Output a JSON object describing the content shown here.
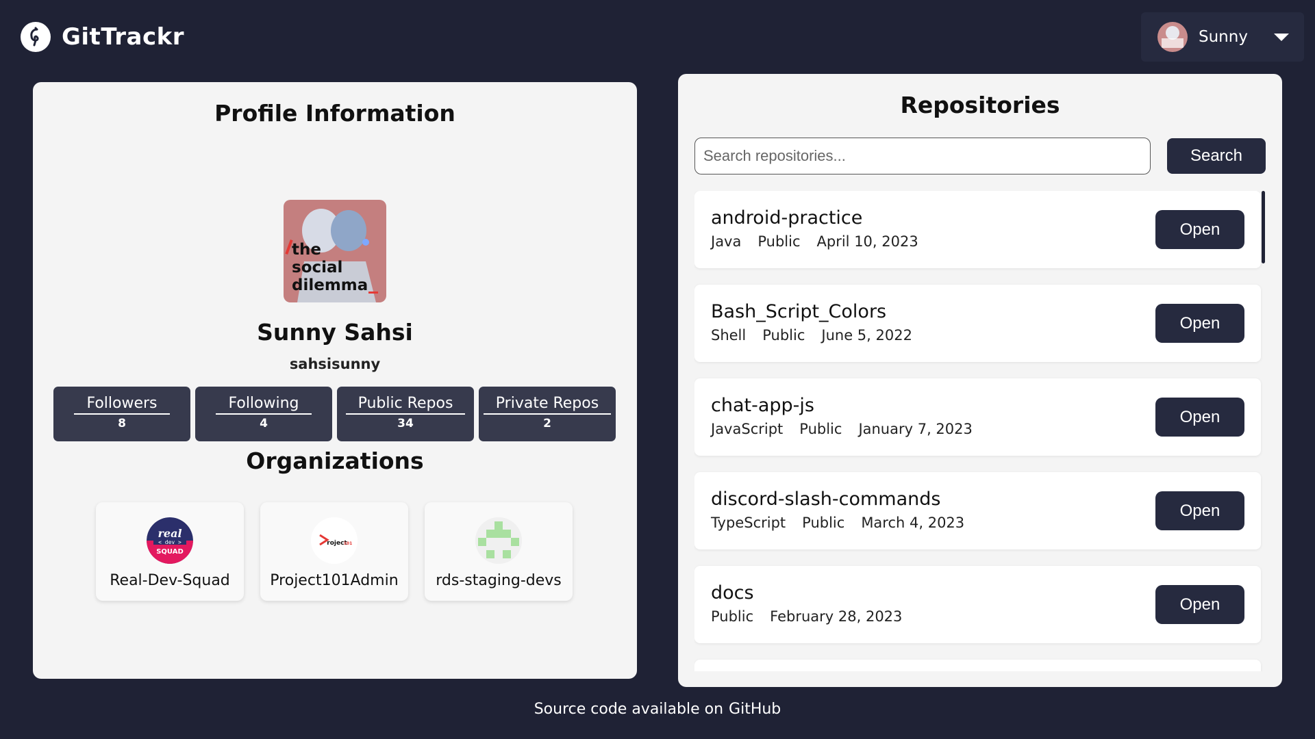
{
  "app": {
    "brand_name": "GitTrackr"
  },
  "user_menu": {
    "name": "Sunny"
  },
  "profile": {
    "title": "Profile Information",
    "full_name": "Sunny Sahsi",
    "username": "sahsisunny",
    "stats": [
      {
        "label": "Followers",
        "value": "8"
      },
      {
        "label": "Following",
        "value": "4"
      },
      {
        "label": "Public Repos",
        "value": "34"
      },
      {
        "label": "Private Repos",
        "value": "2"
      }
    ],
    "organizations_title": "Organizations",
    "organizations": [
      {
        "name": "Real-Dev-Squad"
      },
      {
        "name": "Project101Admin"
      },
      {
        "name": "rds-staging-devs"
      }
    ]
  },
  "repositories": {
    "title": "Repositories",
    "search_placeholder": "Search repositories...",
    "search_button": "Search",
    "open_label": "Open",
    "items": [
      {
        "name": "android-practice",
        "language": "Java",
        "visibility": "Public",
        "date": "April 10, 2023"
      },
      {
        "name": "Bash_Script_Colors",
        "language": "Shell",
        "visibility": "Public",
        "date": "June 5, 2022"
      },
      {
        "name": "chat-app-js",
        "language": "JavaScript",
        "visibility": "Public",
        "date": "January 7, 2023"
      },
      {
        "name": "discord-slash-commands",
        "language": "TypeScript",
        "visibility": "Public",
        "date": "March 4, 2023"
      },
      {
        "name": "docs",
        "language": "",
        "visibility": "Public",
        "date": "February 28, 2023"
      }
    ]
  },
  "footer": {
    "text": "Source code available on",
    "link": "GitHub"
  },
  "colors": {
    "background": "#1f2235",
    "panel": "#f4f4f4",
    "button": "#262a3f",
    "stat_card": "#373a4d"
  }
}
